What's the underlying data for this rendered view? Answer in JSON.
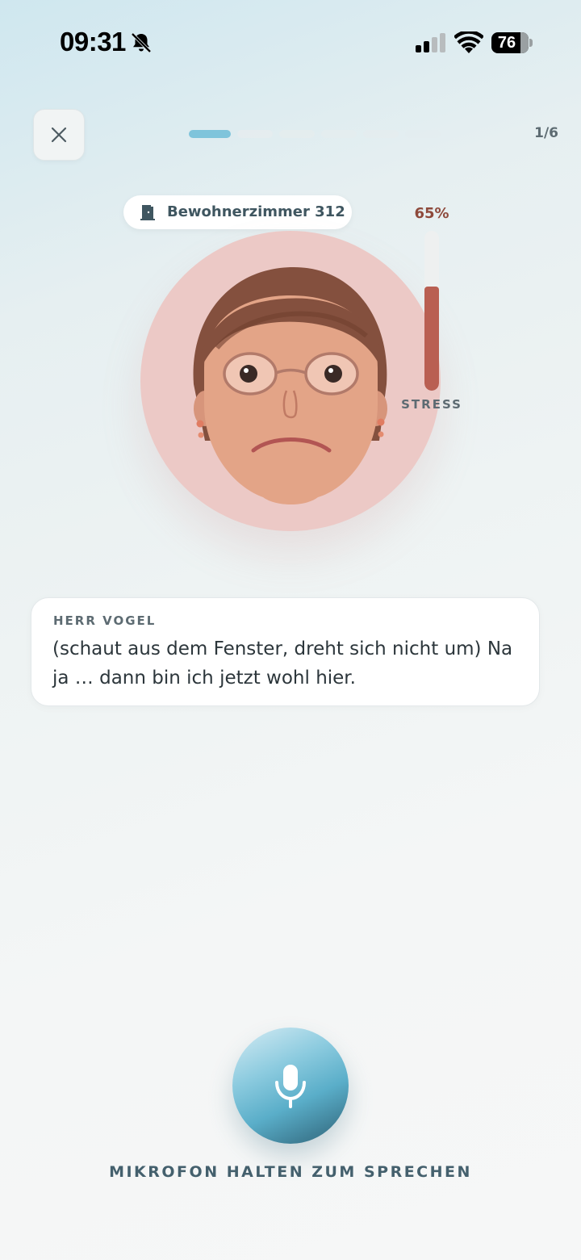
{
  "status_bar": {
    "time": "09:31",
    "battery": "76",
    "icons": [
      "bell-slash-icon",
      "signal-icon",
      "wifi-icon",
      "battery-icon"
    ]
  },
  "header": {
    "close_icon": "close-icon",
    "progress": {
      "current": 1,
      "total": 6
    },
    "step_counter": "1/6"
  },
  "scene": {
    "room_icon": "door-icon",
    "room_label": "Bewohnerzimmer 312",
    "stress": {
      "value": 0.65,
      "percent_label": "65%",
      "label": "STRESS"
    }
  },
  "dialog": {
    "speaker": "HERR VOGEL",
    "text": "(schaut aus dem Fenster, dreht sich nicht um) Na ja … dann bin ich jetzt wohl hier."
  },
  "mic": {
    "icon": "microphone-icon",
    "hint": "MIKROFON HALTEN ZUM SPRECHEN"
  },
  "colors": {
    "accent": "#7fc4db",
    "stress_fill": "#b95f52",
    "face_bg": "#ecc9c6"
  }
}
